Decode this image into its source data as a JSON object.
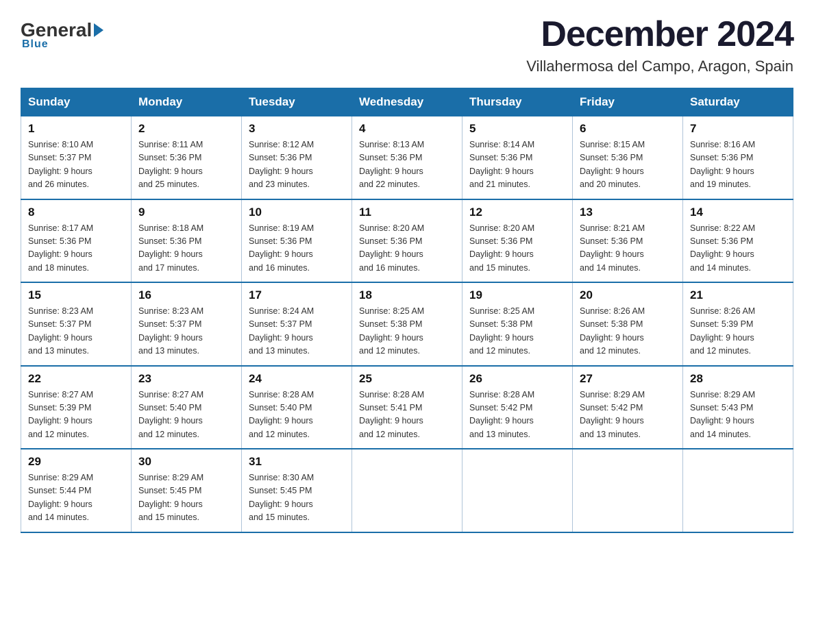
{
  "header": {
    "logo_general": "General",
    "logo_blue": "Blue",
    "month_title": "December 2024",
    "subtitle": "Villahermosa del Campo, Aragon, Spain"
  },
  "weekdays": [
    "Sunday",
    "Monday",
    "Tuesday",
    "Wednesday",
    "Thursday",
    "Friday",
    "Saturday"
  ],
  "weeks": [
    [
      {
        "day": "1",
        "sunrise": "8:10 AM",
        "sunset": "5:37 PM",
        "daylight": "9 hours and 26 minutes."
      },
      {
        "day": "2",
        "sunrise": "8:11 AM",
        "sunset": "5:36 PM",
        "daylight": "9 hours and 25 minutes."
      },
      {
        "day": "3",
        "sunrise": "8:12 AM",
        "sunset": "5:36 PM",
        "daylight": "9 hours and 23 minutes."
      },
      {
        "day": "4",
        "sunrise": "8:13 AM",
        "sunset": "5:36 PM",
        "daylight": "9 hours and 22 minutes."
      },
      {
        "day": "5",
        "sunrise": "8:14 AM",
        "sunset": "5:36 PM",
        "daylight": "9 hours and 21 minutes."
      },
      {
        "day": "6",
        "sunrise": "8:15 AM",
        "sunset": "5:36 PM",
        "daylight": "9 hours and 20 minutes."
      },
      {
        "day": "7",
        "sunrise": "8:16 AM",
        "sunset": "5:36 PM",
        "daylight": "9 hours and 19 minutes."
      }
    ],
    [
      {
        "day": "8",
        "sunrise": "8:17 AM",
        "sunset": "5:36 PM",
        "daylight": "9 hours and 18 minutes."
      },
      {
        "day": "9",
        "sunrise": "8:18 AM",
        "sunset": "5:36 PM",
        "daylight": "9 hours and 17 minutes."
      },
      {
        "day": "10",
        "sunrise": "8:19 AM",
        "sunset": "5:36 PM",
        "daylight": "9 hours and 16 minutes."
      },
      {
        "day": "11",
        "sunrise": "8:20 AM",
        "sunset": "5:36 PM",
        "daylight": "9 hours and 16 minutes."
      },
      {
        "day": "12",
        "sunrise": "8:20 AM",
        "sunset": "5:36 PM",
        "daylight": "9 hours and 15 minutes."
      },
      {
        "day": "13",
        "sunrise": "8:21 AM",
        "sunset": "5:36 PM",
        "daylight": "9 hours and 14 minutes."
      },
      {
        "day": "14",
        "sunrise": "8:22 AM",
        "sunset": "5:36 PM",
        "daylight": "9 hours and 14 minutes."
      }
    ],
    [
      {
        "day": "15",
        "sunrise": "8:23 AM",
        "sunset": "5:37 PM",
        "daylight": "9 hours and 13 minutes."
      },
      {
        "day": "16",
        "sunrise": "8:23 AM",
        "sunset": "5:37 PM",
        "daylight": "9 hours and 13 minutes."
      },
      {
        "day": "17",
        "sunrise": "8:24 AM",
        "sunset": "5:37 PM",
        "daylight": "9 hours and 13 minutes."
      },
      {
        "day": "18",
        "sunrise": "8:25 AM",
        "sunset": "5:38 PM",
        "daylight": "9 hours and 12 minutes."
      },
      {
        "day": "19",
        "sunrise": "8:25 AM",
        "sunset": "5:38 PM",
        "daylight": "9 hours and 12 minutes."
      },
      {
        "day": "20",
        "sunrise": "8:26 AM",
        "sunset": "5:38 PM",
        "daylight": "9 hours and 12 minutes."
      },
      {
        "day": "21",
        "sunrise": "8:26 AM",
        "sunset": "5:39 PM",
        "daylight": "9 hours and 12 minutes."
      }
    ],
    [
      {
        "day": "22",
        "sunrise": "8:27 AM",
        "sunset": "5:39 PM",
        "daylight": "9 hours and 12 minutes."
      },
      {
        "day": "23",
        "sunrise": "8:27 AM",
        "sunset": "5:40 PM",
        "daylight": "9 hours and 12 minutes."
      },
      {
        "day": "24",
        "sunrise": "8:28 AM",
        "sunset": "5:40 PM",
        "daylight": "9 hours and 12 minutes."
      },
      {
        "day": "25",
        "sunrise": "8:28 AM",
        "sunset": "5:41 PM",
        "daylight": "9 hours and 12 minutes."
      },
      {
        "day": "26",
        "sunrise": "8:28 AM",
        "sunset": "5:42 PM",
        "daylight": "9 hours and 13 minutes."
      },
      {
        "day": "27",
        "sunrise": "8:29 AM",
        "sunset": "5:42 PM",
        "daylight": "9 hours and 13 minutes."
      },
      {
        "day": "28",
        "sunrise": "8:29 AM",
        "sunset": "5:43 PM",
        "daylight": "9 hours and 14 minutes."
      }
    ],
    [
      {
        "day": "29",
        "sunrise": "8:29 AM",
        "sunset": "5:44 PM",
        "daylight": "9 hours and 14 minutes."
      },
      {
        "day": "30",
        "sunrise": "8:29 AM",
        "sunset": "5:45 PM",
        "daylight": "9 hours and 15 minutes."
      },
      {
        "day": "31",
        "sunrise": "8:30 AM",
        "sunset": "5:45 PM",
        "daylight": "9 hours and 15 minutes."
      },
      null,
      null,
      null,
      null
    ]
  ],
  "labels": {
    "sunrise": "Sunrise:",
    "sunset": "Sunset:",
    "daylight": "Daylight:"
  }
}
